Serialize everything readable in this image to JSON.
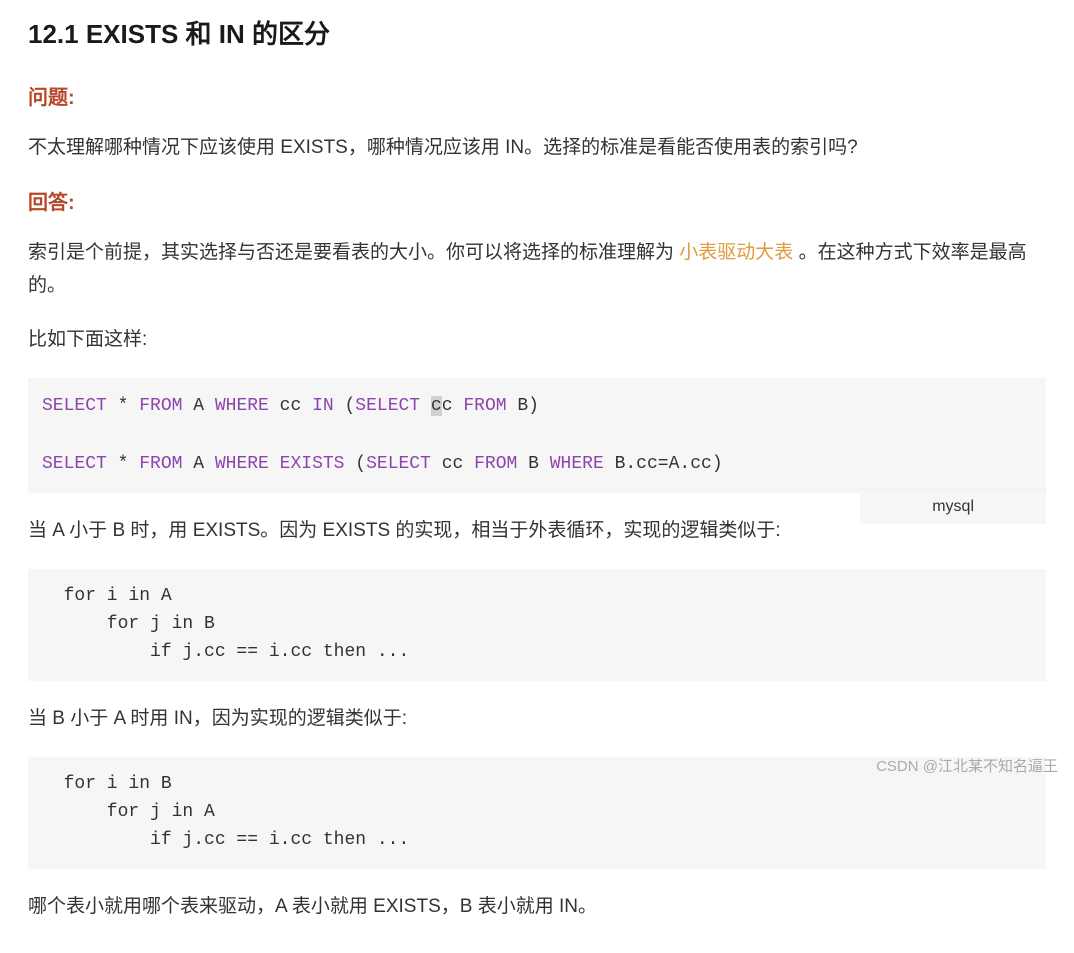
{
  "heading": "12.1 EXISTS 和 IN 的区分",
  "question_label": "问题:",
  "question_text": "不太理解哪种情况下应该使用 EXISTS，哪种情况应该用 IN。选择的标准是看能否使用表的索引吗?",
  "answer_label": "回答:",
  "answer_text_a": "索引是个前提，其实选择与否还是要看表的大小。你可以将选择的标准理解为 ",
  "answer_highlight": "小表驱动大表",
  "answer_text_b": " 。在这种方式下效率是最高的。",
  "example_intro": "比如下面这样:",
  "sql": {
    "kw_select": "SELECT",
    "kw_from": "FROM",
    "kw_where": "WHERE",
    "kw_in": "IN",
    "kw_exists": "EXISTS",
    "line1_tokens": {
      "star": " * ",
      "a": " A ",
      "cc": " cc ",
      "open": " (",
      "cc2_pre": " ",
      "cc2_sel": "c",
      "cc2_post": "c ",
      "b": " B",
      "close": ")"
    },
    "line2_tokens": {
      "star": " * ",
      "a": " A ",
      "open": " (",
      "cc": " cc ",
      "b": " B ",
      "bcc": " B.cc",
      "eq": "=",
      "acc": "A.cc",
      "close": ")"
    }
  },
  "lang_tag": "mysql",
  "para_exists": "当 A 小于 B 时，用 EXISTS。因为 EXISTS 的实现，相当于外表循环，实现的逻辑类似于:",
  "pseudo1": {
    "l1": "  for i in A",
    "l2": "      for j in B",
    "l3": "          if j.cc == i.cc then ..."
  },
  "para_in": "当 B 小于 A 时用 IN，因为实现的逻辑类似于:",
  "pseudo2": {
    "l1": "  for i in B",
    "l2": "      for j in A",
    "l3": "          if j.cc == i.cc then ..."
  },
  "conclusion": "哪个表小就用哪个表来驱动，A 表小就用 EXISTS，B 表小就用 IN。",
  "watermark": "CSDN @江北某不知名逼王"
}
